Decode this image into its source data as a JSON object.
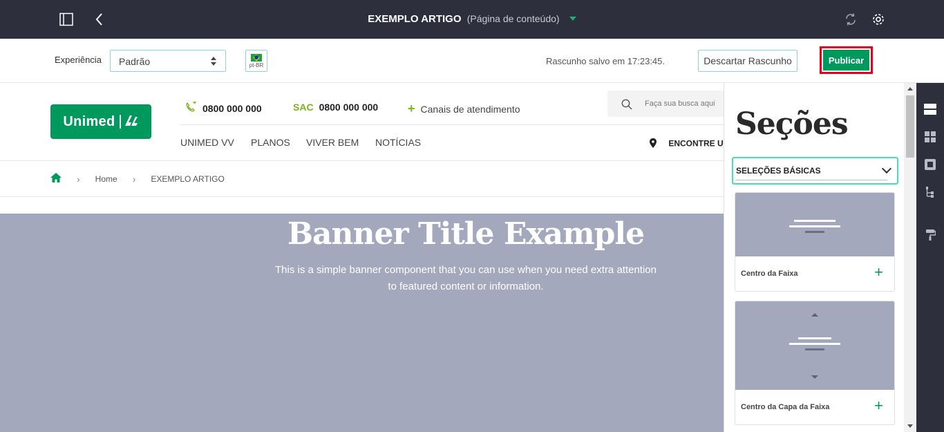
{
  "topbar": {
    "title": "EXEMPLO ARTIGO",
    "subtitle": "(Página de conteúdo)",
    "icons": [
      "sidebar-toggle-icon",
      "back-icon",
      "sync-icon",
      "gear-icon"
    ]
  },
  "toolbar": {
    "experience_label": "Experiência",
    "experience_value": "Padrão",
    "language_code": "pt-BR",
    "draft_status": "Rascunho salvo em 17:23:45.",
    "discard_label": "Descartar Rascunho",
    "publish_label": "Publicar"
  },
  "site": {
    "logo_text": "Unimed",
    "phone": "0800 000 000",
    "sac_label": "SAC",
    "sac_phone": "0800 000 000",
    "channels_label": "Canais de atendimento",
    "search_placeholder": "Faça sua busca aqui",
    "nav": [
      "UNIMED VV",
      "PLANOS",
      "VIVER BEM",
      "NOTÍCIAS"
    ],
    "find_label": "ENCONTRE U",
    "breadcrumb": {
      "home": "Home",
      "current": "EXEMPLO ARTIGO"
    },
    "banner": {
      "title": "Banner Title Example",
      "text_line1": "This is a simple banner component that you can use when you need extra attention",
      "text_line2": "to featured content or information."
    }
  },
  "panel": {
    "title": "Seções",
    "dropdown_value": "SELEÇÕES BÁSICAS",
    "cards": [
      {
        "label": "Centro da Faixa"
      },
      {
        "label": "Centro da Capa da Faixa"
      }
    ]
  },
  "colors": {
    "brand_green": "#00995d",
    "accent_teal": "#43e0b4",
    "dark_bg": "#2d2f3d",
    "banner_bg": "#a4a8bc",
    "highlight_red": "#e3001b"
  }
}
